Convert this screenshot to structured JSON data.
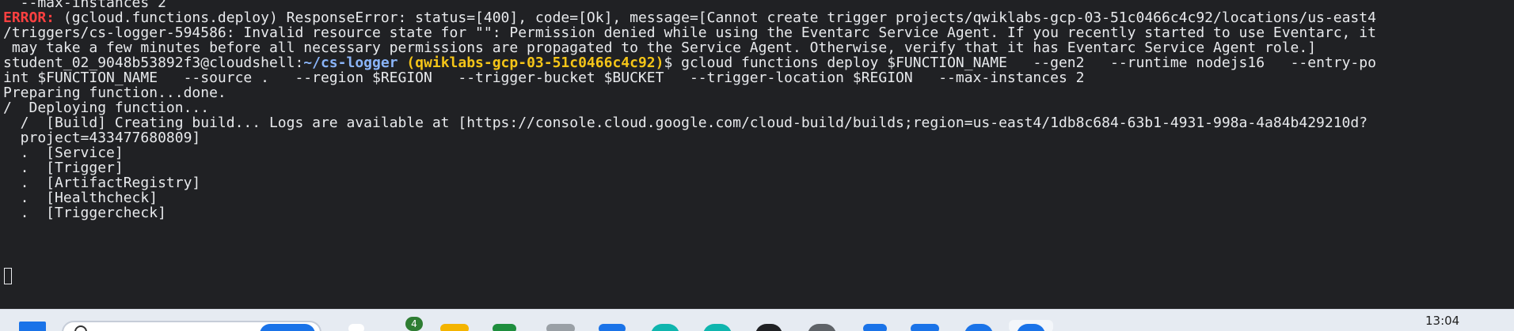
{
  "terminal": {
    "l0": "  --max-instances 2",
    "l1_err": "ERROR:",
    "l1_rest": " (gcloud.functions.deploy) ResponseError: status=[400], code=[Ok], message=[Cannot create trigger projects/qwiklabs-gcp-03-51c0466c4c92/locations/us-east4",
    "l2": "/triggers/cs-logger-594586: Invalid resource state for \"\": Permission denied while using the Eventarc Service Agent. If you recently started to use Eventarc, it",
    "l3": " may take a few minutes before all necessary permissions are propagated to the Service Agent. Otherwise, verify that it has Eventarc Service Agent role.]",
    "prompt_user": "student_02_9048b53892f3@cloudshell:",
    "prompt_path": "~/cs-logger",
    "prompt_project": " (qwiklabs-gcp-03-51c0466c4c92)",
    "prompt_cmd": "$ gcloud functions deploy $FUNCTION_NAME   --gen2   --runtime nodejs16   --entry-po",
    "l5": "int $FUNCTION_NAME   --source .   --region $REGION   --trigger-bucket $BUCKET   --trigger-location $REGION   --max-instances 2",
    "l6": "Preparing function...done.",
    "l7": "/  Deploying function...",
    "l8": "  /  [Build] Creating build... Logs are available at [https://console.cloud.google.com/cloud-build/builds;region=us-east4/1db8c684-63b1-4931-998a-4a84b429210d?",
    "l9": "  project=433477680809]",
    "l10": "  .  [Service]",
    "l11": "  .  [Trigger]",
    "l12": "  .  [ArtifactRegistry]",
    "l13": "  .  [Healthcheck]",
    "l14": "  .  [Triggercheck]"
  },
  "taskbar": {
    "badge": "4",
    "clock": "13:04"
  },
  "colors": {
    "background": "#202124",
    "error": "#ff4040",
    "path": "#8ab4f8",
    "project": "#f5c518"
  }
}
